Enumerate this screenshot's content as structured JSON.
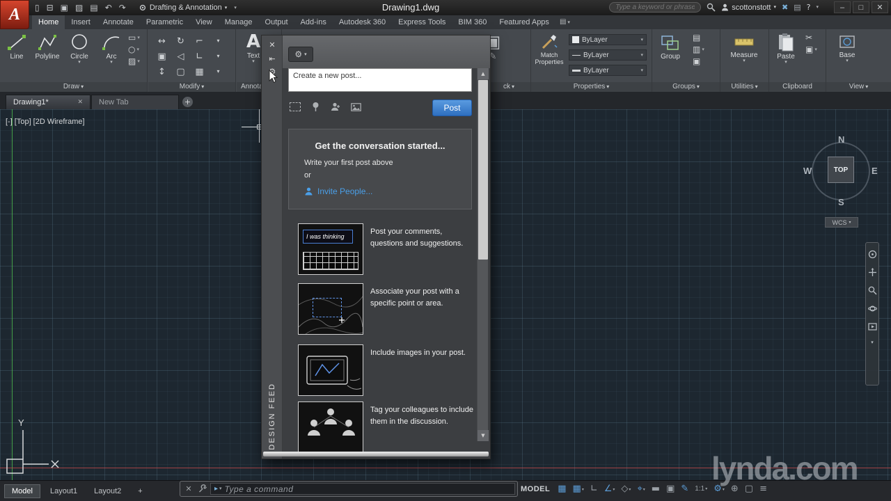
{
  "ui": {
    "caret": "▾",
    "close": "✕",
    "up_arrow": "▲",
    "down_arrow": "▼",
    "plus": "+",
    "app_letter": "A"
  },
  "titlebar": {
    "workspace": "Drafting & Annotation",
    "doc_title": "Drawing1.dwg",
    "search_placeholder": "Type a keyword or phrase",
    "username": "scottonstott",
    "help_glyph": "?",
    "exchange_glyph": "✖",
    "qat_icons": [
      {
        "name": "new-file-icon",
        "glyph": "▯"
      },
      {
        "name": "open-file-icon",
        "glyph": "⊟"
      },
      {
        "name": "save-file-icon",
        "glyph": "▣"
      },
      {
        "name": "save-as-icon",
        "glyph": "▨"
      },
      {
        "name": "plot-icon",
        "glyph": "▤"
      },
      {
        "name": "undo-icon",
        "glyph": "↶"
      },
      {
        "name": "redo-icon",
        "glyph": "↷"
      }
    ],
    "window_buttons": {
      "minimize": "–",
      "maximize": "□",
      "close": "✕"
    }
  },
  "ribbon_tabs": [
    "Home",
    "Insert",
    "Annotate",
    "Parametric",
    "View",
    "Manage",
    "Output",
    "Add-ins",
    "Autodesk 360",
    "Express Tools",
    "BIM 360",
    "Featured Apps"
  ],
  "ribbon": {
    "panels": {
      "draw": {
        "label": "Draw",
        "line": "Line",
        "polyline": "Polyline",
        "circle": "Circle",
        "arc": "Arc",
        "small_icons": [
          {
            "name": "rectangle-tool-icon",
            "glyph": "▭"
          },
          {
            "name": "ellipse-tool-icon",
            "glyph": "○"
          },
          {
            "name": "hatch-tool-icon",
            "glyph": "▨"
          }
        ]
      },
      "modify": {
        "label": "Modify",
        "icons": [
          {
            "name": "move-icon",
            "glyph": "↔"
          },
          {
            "name": "rotate-icon",
            "glyph": "↻"
          },
          {
            "name": "trim-icon",
            "glyph": "⌐"
          },
          {
            "name": "modify-flyout-1",
            "glyph": "▾"
          },
          {
            "name": "copy-icon",
            "glyph": "▣"
          },
          {
            "name": "mirror-icon",
            "glyph": "◁"
          },
          {
            "name": "fillet-icon",
            "glyph": "∟"
          },
          {
            "name": "modify-flyout-2",
            "glyph": "▾"
          },
          {
            "name": "stretch-icon",
            "glyph": "↕"
          },
          {
            "name": "scale-icon",
            "glyph": "▢"
          },
          {
            "name": "array-icon",
            "glyph": "▦"
          },
          {
            "name": "modify-flyout-3",
            "glyph": "▾"
          }
        ]
      },
      "annotation": {
        "label": "Annotat",
        "text": "Text"
      },
      "block": {
        "label": "ck"
      },
      "properties": {
        "label": "Properties",
        "match": "Match Properties",
        "color": "ByLayer",
        "linetype": "ByLayer",
        "lineweight": "ByLayer"
      },
      "groups": {
        "label": "Groups",
        "group": "Group"
      },
      "utilities": {
        "label": "Utilities",
        "measure": "Measure"
      },
      "clipboard": {
        "label": "Clipboard",
        "paste": "Paste",
        "cut_glyph": "✂"
      },
      "view": {
        "label": "View",
        "base": "Base"
      }
    }
  },
  "file_tabs": {
    "drawing1": "Drawing1*",
    "new_tab": "New Tab"
  },
  "viewport": {
    "minimize": "[-]",
    "view": "[Top]",
    "visual_style": "[2D Wireframe]"
  },
  "viewcube": {
    "n": "N",
    "e": "E",
    "s": "S",
    "w": "W",
    "top": "TOP",
    "wcs": "WCS"
  },
  "design_feed": {
    "title_vertical": "DESIGN FEED",
    "post_placeholder": "Create a new post...",
    "post_button": "Post",
    "empty_heading": "Get the conversation started...",
    "empty_line1": "Write your first post above",
    "empty_or": "or",
    "invite_link": "Invite People...",
    "tips": [
      {
        "thumb_caption": "I was thinking",
        "text": "Post your comments, questions and suggestions."
      },
      {
        "text": "Associate your post with a specific point or area."
      },
      {
        "text": "Include images in your post."
      },
      {
        "text": "Tag your colleagues to include them in the discussion."
      }
    ]
  },
  "command_line": {
    "prompt_placeholder": "Type a command"
  },
  "statusbar": {
    "model_tab": "Model",
    "layout1_tab": "Layout1",
    "layout2_tab": "Layout2",
    "plus_tab": "+",
    "mode_label": "MODEL",
    "icons": [
      {
        "name": "grid-display-icon",
        "glyph": "▦"
      },
      {
        "name": "snap-mode-icon",
        "glyph": "▦"
      },
      {
        "name": "ortho-mode-icon",
        "glyph": "∟"
      },
      {
        "name": "polar-tracking-icon",
        "glyph": "∠"
      },
      {
        "name": "isometric-drafting-icon",
        "glyph": "◇"
      },
      {
        "name": "object-snap-icon",
        "glyph": "⌖"
      },
      {
        "name": "lineweight-icon",
        "glyph": "▬"
      },
      {
        "name": "selection-cycling-icon",
        "glyph": "▣"
      },
      {
        "name": "annotation-visibility-icon",
        "glyph": "✎"
      },
      {
        "name": "annotation-scale-icon",
        "glyph": "1:1"
      },
      {
        "name": "workspace-switching-icon",
        "glyph": "⚙"
      },
      {
        "name": "annotation-monitor-icon",
        "glyph": "⊕"
      },
      {
        "name": "clean-screen-icon",
        "glyph": "▢"
      },
      {
        "name": "customization-icon",
        "glyph": "≡"
      }
    ]
  },
  "watermark": "lynda.com"
}
